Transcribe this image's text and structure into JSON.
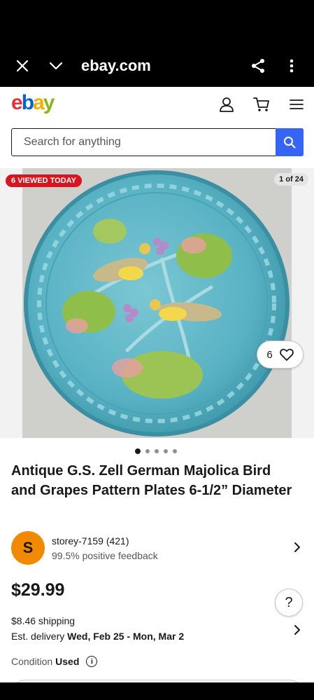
{
  "browser": {
    "domain": "ebay.com"
  },
  "header": {
    "logo_letters": [
      "e",
      "b",
      "a",
      "y"
    ],
    "account_icon": "person-icon",
    "cart_icon": "cart-icon",
    "menu_icon": "hamburger-icon"
  },
  "search": {
    "placeholder": "Search for anything"
  },
  "gallery": {
    "badge": "6 VIEWED TODAY",
    "counter": "1 of 24",
    "image_count": 5,
    "active_index": 0
  },
  "watch": {
    "count": "6"
  },
  "listing": {
    "title": "Antique G.S. Zell German Majolica Bird and Grapes Pattern Plates 6-1/2” Diameter",
    "price": "$29.99"
  },
  "seller": {
    "initial": "S",
    "name": "storey-7159 (421)",
    "feedback": "99.5% positive feedback"
  },
  "shipping": {
    "cost": "$8.46 shipping",
    "delivery_label": "Est. delivery",
    "delivery_dates": "Wed, Feb 25 - Mon, Mar 2"
  },
  "condition": {
    "label": "Condition",
    "value": "Used"
  },
  "help": {
    "label": "?"
  },
  "colors": {
    "ebay_red": "#e53238",
    "ebay_blue": "#0064d2",
    "ebay_yellow": "#f5af02",
    "ebay_green": "#86b817",
    "search_button": "#3665f3",
    "badge_red": "#d9141f",
    "avatar_orange": "#f18a00",
    "plate_turquoise": "#5fb6c7"
  }
}
